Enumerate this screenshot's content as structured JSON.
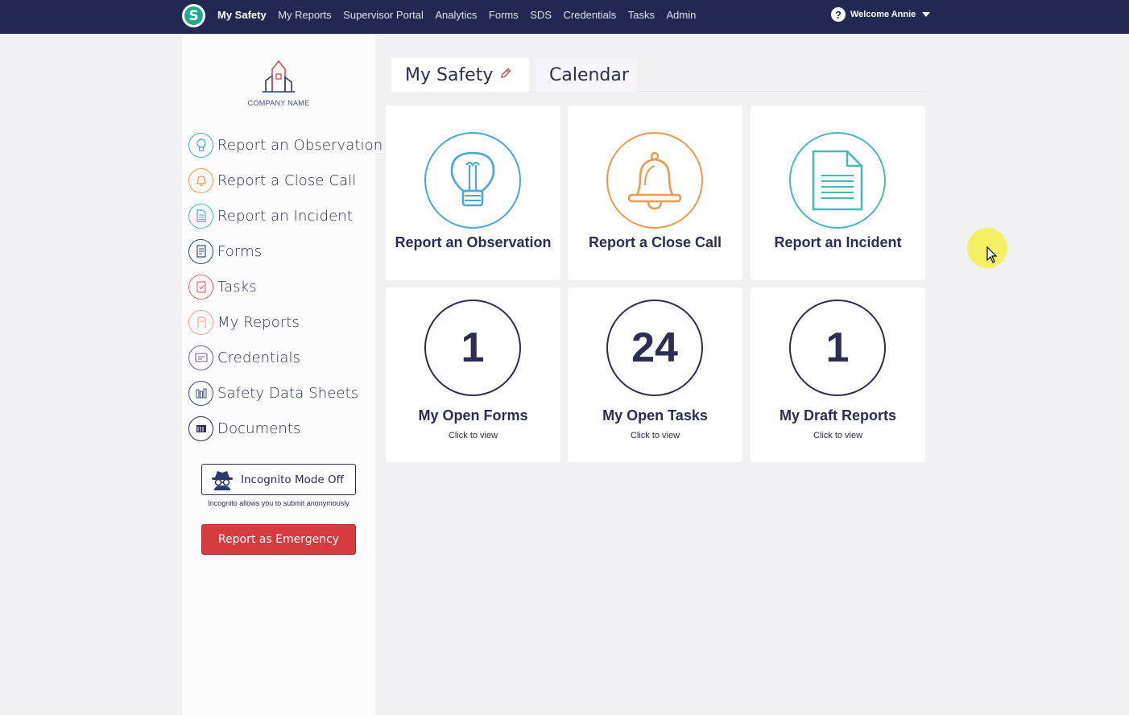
{
  "topbar": {
    "brand_letter": "S",
    "nav": [
      "My Safety",
      "My Reports",
      "Supervisor Portal",
      "Analytics",
      "Forms",
      "SDS",
      "Credentials",
      "Tasks",
      "Admin"
    ],
    "help_glyph": "?",
    "welcome": "Welcome Annie"
  },
  "sidebar": {
    "logo_text": "COMPANY NAME",
    "items": [
      {
        "label": "Report an Observation",
        "icon": "lightbulb-icon",
        "color": "#4aa8d8"
      },
      {
        "label": "Report a Close Call",
        "icon": "bell-icon",
        "color": "#ec9a4e"
      },
      {
        "label": "Report an Incident",
        "icon": "document-icon",
        "color": "#4bb8b8"
      },
      {
        "label": "Forms",
        "icon": "form-icon",
        "color": "#2b4a7c"
      },
      {
        "label": "Tasks",
        "icon": "clipboard-icon",
        "color": "#e06b63"
      },
      {
        "label": "My Reports",
        "icon": "reports-icon",
        "color": "#f0a48f"
      },
      {
        "label": "Credentials",
        "icon": "id-card-icon",
        "color": "#7b5a9c"
      },
      {
        "label": "Safety Data Sheets",
        "icon": "flask-icon",
        "color": "#3b4a7c"
      },
      {
        "label": "Documents",
        "icon": "folder-icon",
        "color": "#2b2d52"
      }
    ],
    "incognito_label": "Incognito Mode Off",
    "incognito_note": "Incognito allows you to submit anonymously",
    "emergency_label": "Report as Emergency"
  },
  "tabs": {
    "my_safety": "My Safety",
    "calendar": "Calendar"
  },
  "actions": [
    {
      "title": "Report an Observation",
      "icon": "lightbulb-icon",
      "color": "#4aa8d8"
    },
    {
      "title": "Report a Close Call",
      "icon": "bell-icon",
      "color": "#ec9a4e"
    },
    {
      "title": "Report an Incident",
      "icon": "document-icon",
      "color": "#4bb8b8"
    }
  ],
  "counters": [
    {
      "count": "1",
      "title": "My Open Forms",
      "sub": "Click to view"
    },
    {
      "count": "24",
      "title": "My Open Tasks",
      "sub": "Click to view"
    },
    {
      "count": "1",
      "title": "My Draft Reports",
      "sub": "Click to view"
    }
  ]
}
